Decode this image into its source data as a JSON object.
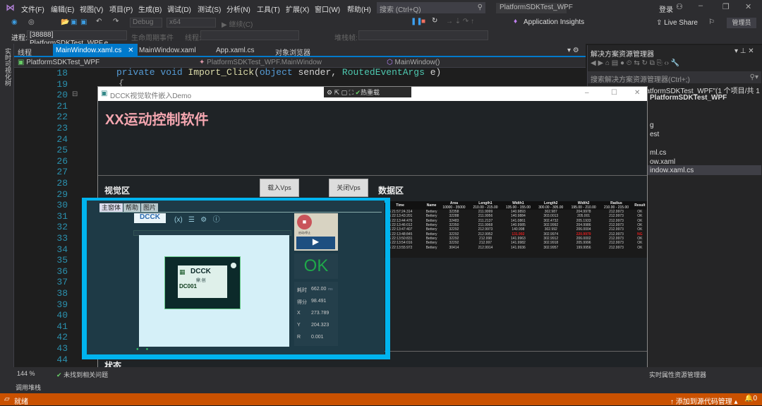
{
  "menubar": {
    "items": [
      "文件(F)",
      "编辑(E)",
      "视图(V)",
      "项目(P)",
      "生成(B)",
      "调试(D)",
      "测试(S)",
      "分析(N)",
      "工具(T)",
      "扩展(X)",
      "窗口(W)",
      "帮助(H)"
    ],
    "search_placeholder": "搜索 (Ctrl+Q)",
    "solution_name": "PlatformSDKTest_WPF",
    "login": "登录",
    "admin_badge": "管理员"
  },
  "toolbar": {
    "config": "Debug",
    "platform": "x64",
    "continue": "继续(C)",
    "app_insights": "Application Insights",
    "live_share": "Live Share",
    "process_label": "进程:",
    "process_value": "[38888] PlatformSDKTest_WPF.e",
    "lifecycle": "生命周期事件",
    "thread_label": "线程:",
    "stack_label": "堆栈帧:"
  },
  "side_strip": "实时可视化树",
  "tabs": [
    {
      "label": "线程",
      "active": false
    },
    {
      "label": "MainWindow.xaml.cs",
      "active": true
    },
    {
      "label": "MainWindow.xaml",
      "active": false
    },
    {
      "label": "App.xaml.cs",
      "active": false
    },
    {
      "label": "对象浏览器",
      "active": false
    }
  ],
  "navbar": {
    "project": "PlatformSDKTest_WPF",
    "class": "PlatformSDKTest_WPF.MainWindow",
    "member": "MainWindow()"
  },
  "editor": {
    "line_start": 18,
    "line_end": 44,
    "code_line": "private void Import_Click(object sender, RoutedEventArgs e)",
    "brace": "{"
  },
  "solution_explorer": {
    "title": "解决方案资源管理器",
    "search_placeholder": "搜索解决方案资源管理器(Ctrl+;)",
    "rows": [
      "解决方案\"PlatformSDKTest_WPF\"(1 个项目/共 1 个)",
      "PlatformSDKTest_WPF",
      "g",
      "est",
      "ml.cs",
      "ow.xaml",
      "indow.xaml.cs"
    ]
  },
  "app_window": {
    "title": "DCCK视觉软件嵌入Demo",
    "hot_reload": "热重载",
    "heading": "XX运动控制软件",
    "heading_color": "#f4a6b0",
    "vision_label": "视觉区",
    "load_btn": "载入Vps",
    "close_btn": "关闭Vps",
    "data_label": "数据区",
    "state_label": "状态"
  },
  "vision_app": {
    "tabs": [
      "主窗体",
      "帮助",
      "图片"
    ],
    "logo": "DCCK",
    "start_stop": "启动/停止",
    "result": "OK",
    "result_color": "#1fa84a",
    "part_code": "DC001",
    "part_brand": "DCCK",
    "part_sub": "鼎 创",
    "stats": [
      {
        "k": "耗时",
        "v": "662.00",
        "u": "ms"
      },
      {
        "k": "得分",
        "v": "98.491"
      },
      {
        "k": "X",
        "v": "273.789"
      },
      {
        "k": "Y",
        "v": "204.323"
      },
      {
        "k": "R",
        "v": "0.001"
      }
    ]
  },
  "data_table": {
    "headers": [
      {
        "name": "Time",
        "range": ""
      },
      {
        "name": "Name",
        "range": ""
      },
      {
        "name": "Area",
        "range": "10000 - 35000"
      },
      {
        "name": "Length1",
        "range": "210.00 - 215.00"
      },
      {
        "name": "Width1",
        "range": "135.00 - 155.00"
      },
      {
        "name": "Length2",
        "range": "300.00 - 305.00"
      },
      {
        "name": "Width2",
        "range": "195.00 - 210.00"
      },
      {
        "name": "Radius",
        "range": "210.00 - 215.00"
      },
      {
        "name": "Result",
        "range": ""
      }
    ],
    "rows": [
      [
        "2022",
        "/06 21:57:24.314",
        "Bettery",
        "32358",
        "211.9999",
        "140.9893",
        "302.987",
        "204.9978",
        "212.9973",
        "OK"
      ],
      [
        "2022",
        "/06 22:13:43:201",
        "Bettery",
        "32288",
        "211.9956",
        "140.9884",
        "303.0013",
        "205.001",
        "212.9973",
        "OK"
      ],
      [
        "2022",
        "/06 22:13:44:476",
        "Bettery",
        "32483",
        "211.2137",
        "141.0861",
        "302.4732",
        "205.1933",
        "212.9973",
        "OK"
      ],
      [
        "2022",
        "/06 22:13:46:012",
        "Bettery",
        "32350",
        "211.9968",
        "140.9985",
        "302.9992",
        "204.9986",
        "212.9973",
        "OK"
      ],
      [
        "2022",
        "/06 22:13:47:407",
        "Bettery",
        "32292",
        "212.9973",
        "140.998",
        "302.992",
        "206.0004",
        "212.9973",
        "OK"
      ],
      [
        "2022",
        "/06 22:13:48:845",
        "Bettery",
        "32292",
        "212.9952",
        "131.992",
        "302.9974",
        "220.9979",
        "212.9973",
        "NG"
      ],
      [
        "2022",
        "/06 22:13:50:831",
        "Bettery",
        "32292",
        "212.998",
        "141.9963",
        "302.9912",
        "206.0002",
        "212.9973",
        "OK"
      ],
      [
        "2022",
        "/06 22:13:54:016",
        "Bettery",
        "32292",
        "212.997",
        "141.9982",
        "302.9918",
        "205.9996",
        "212.9973",
        "OK"
      ],
      [
        "2022",
        "/06 22:13:55:972",
        "Bettery",
        "30414",
        "212.9914",
        "141.9936",
        "302.9957",
        "199.9956",
        "212.9973",
        "OK"
      ]
    ],
    "error_color": "#e02020"
  },
  "statusline": {
    "zoom": "144 %",
    "issues": "未找到相关问题",
    "live_props": "实时属性资源管理器",
    "call_stack": "调用堆栈"
  },
  "statusbar": {
    "ready": "就绪",
    "source_control": "添加到源代码管理",
    "notifications": "0",
    "color": "#ca5100"
  }
}
